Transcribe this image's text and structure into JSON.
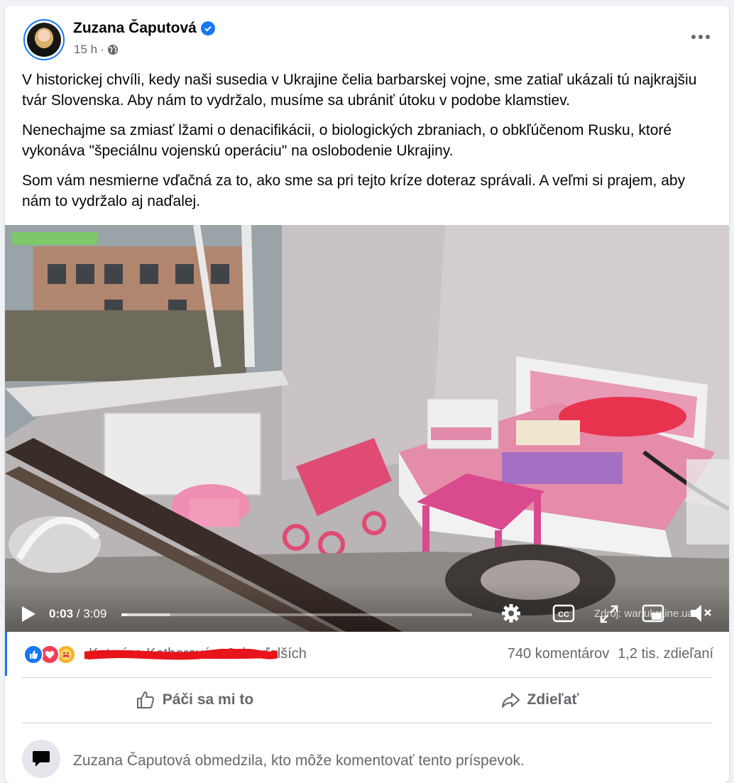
{
  "post": {
    "author": "Zuzana Čaputová",
    "time": "15 h",
    "separator": "·",
    "paragraphs": [
      "V historickej chvíli, kedy naši susedia v Ukrajine čelia barbarskej vojne, sme zatiaľ ukázali tú najkrajšiu tvár Slovenska. Aby nám to vydržalo, musíme sa ubrániť útoku v podobe klamstiev.",
      "Nenechajme sa zmiasť lžami o denacifikácii, o biologických zbraniach, o obkľúčenom Rusku, ktoré vykonáva \"špeciálnu vojenskú operáciu\" na oslobodenie Ukrajiny.",
      "Som vám nesmierne vďačná za to, ako sme sa pri tejto kríze doteraz správali. A veľmi si prajem, aby nám to vydržalo aj naďalej."
    ]
  },
  "video": {
    "current_time": "0:03",
    "duration": "/ 3:09",
    "progress": 0.016,
    "buffered": 0.14,
    "credit": "Zdroj: war.ukraine.ua"
  },
  "stats": {
    "reactions_names": "Katarína Ketherová a 8 tis. ďalších",
    "reactions_suffix": "a 8 tis. ďalších",
    "comments": "740 komentárov",
    "shares": "1,2 tis. zdieľaní"
  },
  "actions": {
    "like_label": "Páči sa mi to",
    "share_label": "Zdieľať"
  },
  "restriction": {
    "text": "Zuzana Čaputová obmedzila, kto môže komentovať tento príspevok."
  },
  "colors": {
    "brand": "#1877f2",
    "secondary_text": "#65676b",
    "redaction": "#e8141b"
  }
}
